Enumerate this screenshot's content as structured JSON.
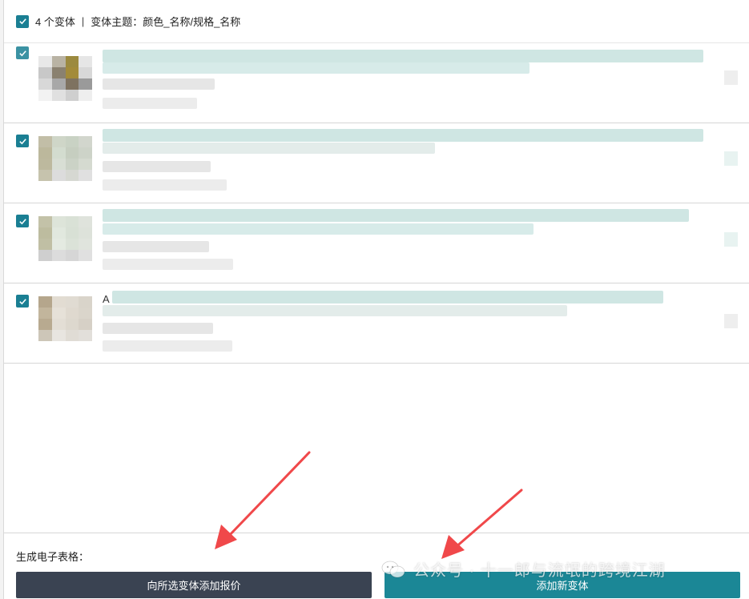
{
  "header": {
    "variant_count": "4 个变体",
    "separator": "|",
    "theme": "变体主题：颜色_名称/规格_名称"
  },
  "rows": [
    {
      "title_prefix": ""
    },
    {
      "title_prefix": ""
    },
    {
      "title_prefix": ""
    },
    {
      "title_prefix": "A"
    }
  ],
  "footer": {
    "label": "生成电子表格：",
    "add_quote_button": "向所选变体添加报价",
    "add_variant_button": "添加新变体"
  },
  "watermark": {
    "text": "公众号 · 十一郎与流氓的跨境江湖",
    "icon": "wechat-icon"
  },
  "colors": {
    "checkbox": "#1a7f93",
    "primary_button": "#1b8796",
    "secondary_button": "#3a4352",
    "annotation_arrow": "#f0484a"
  }
}
